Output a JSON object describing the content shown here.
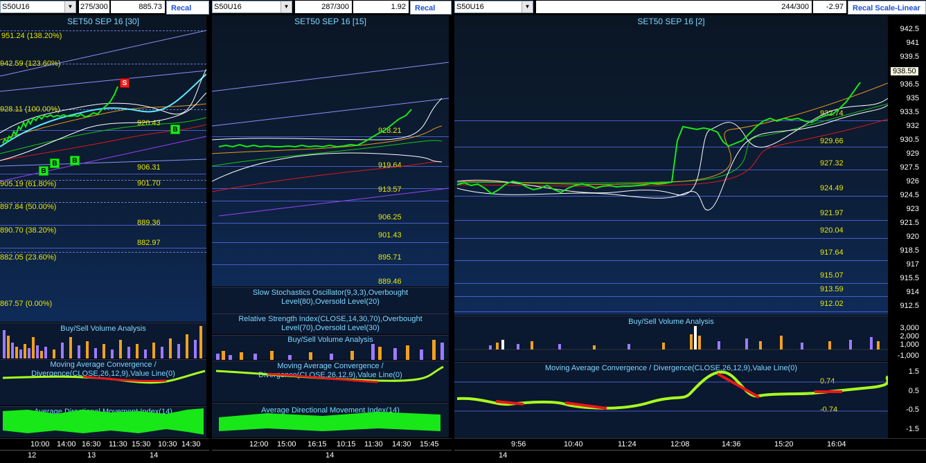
{
  "panels": [
    {
      "symbol": "S50U16",
      "bars": "275/300",
      "value": "885.73",
      "recal": "Recal Scale",
      "title": "SET50 SEP 16  [30]",
      "fib_levels": [
        "951.24 (138.20%)",
        "942.59 (123.60%)",
        "928.11 (100.00%)",
        "905.19 (61.80%)",
        "897.84 (50.00%)",
        "890.70 (38.20%)",
        "882.05 (23.60%)",
        "867.57 (0.00%)"
      ],
      "levels": [
        "920.43",
        "906.31",
        "901.70",
        "889.36",
        "882.97"
      ],
      "subtitles": [
        "Buy/Sell Volume Analysis",
        "Moving Average Convergence / Divergence(CLOSE,26,12,9),Value Line(0)",
        "Average Directional Movement Index(14)"
      ],
      "times": [
        "10:00",
        "14:00",
        "16:30",
        "11:30",
        "15:30",
        "10:30",
        "14:30"
      ],
      "dates": [
        "12",
        "13",
        "14"
      ],
      "signals": [
        "B",
        "B",
        "B",
        "B",
        "S"
      ]
    },
    {
      "symbol": "S50U16",
      "bars": "287/300",
      "value": "1.92",
      "recal": "Recal Scal",
      "title": "SET50 SEP 16  [15]",
      "levels": [
        "928.21",
        "919.64",
        "913.57",
        "906.25",
        "901.43",
        "895.71",
        "889.46"
      ],
      "subtitles": [
        "Slow Stochastics Oscillator(9,3,3),Overbought Level(80),Oversold Level(20)",
        "Relative Strength Index(CLOSE,14,30,70),Overbought Level(70),Oversold Level(30)",
        "Buy/Sell Volume Analysis",
        "Moving Average Convergence / Divergence(CLOSE,26,12,9),Value Line(0)",
        "Average Directional Movement Index(14)"
      ],
      "times": [
        "12:00",
        "15:00",
        "16:15",
        "10:15",
        "11:30",
        "14:30",
        "15:45"
      ],
      "dates": [
        "14"
      ]
    },
    {
      "symbol": "S50U16",
      "bars": "244/300",
      "value": "-2.97",
      "recal": "Recal Scale-Linear",
      "title": "SET50 SEP 16  [2]",
      "levels": [
        "932.74",
        "929.66",
        "927.32",
        "924.49",
        "921.97",
        "920.04",
        "917.64",
        "915.07",
        "913.59",
        "912.02"
      ],
      "price_axis": [
        "942.5",
        "941",
        "939.5",
        "938.50",
        "936.5",
        "935",
        "933.5",
        "932",
        "930.5",
        "929",
        "927.5",
        "926",
        "924.5",
        "923",
        "921.5",
        "920",
        "918.5",
        "917",
        "915.5",
        "914",
        "912.5"
      ],
      "last_price": "938.50",
      "subtitles": [
        "Buy/Sell Volume Analysis",
        "Moving Average Convergence / Divergence(CLOSE,26,12,9),Value Line(0)"
      ],
      "volume_axis": [
        "3,000",
        "2,000",
        "1,000",
        "-1,000"
      ],
      "macd_axis": [
        "1.5",
        "0.5",
        "-0.5",
        "-1.5"
      ],
      "macd_levels": [
        "0.74",
        "-0.74"
      ],
      "times": [
        "9:56",
        "10:40",
        "11:24",
        "12:08",
        "14:36",
        "15:20",
        "16:04"
      ],
      "dates": [
        "14"
      ]
    }
  ],
  "colors": {
    "accent": "#7fd8ff",
    "level": "#e8e800",
    "buy": "#18e818",
    "sell": "#e82020"
  }
}
